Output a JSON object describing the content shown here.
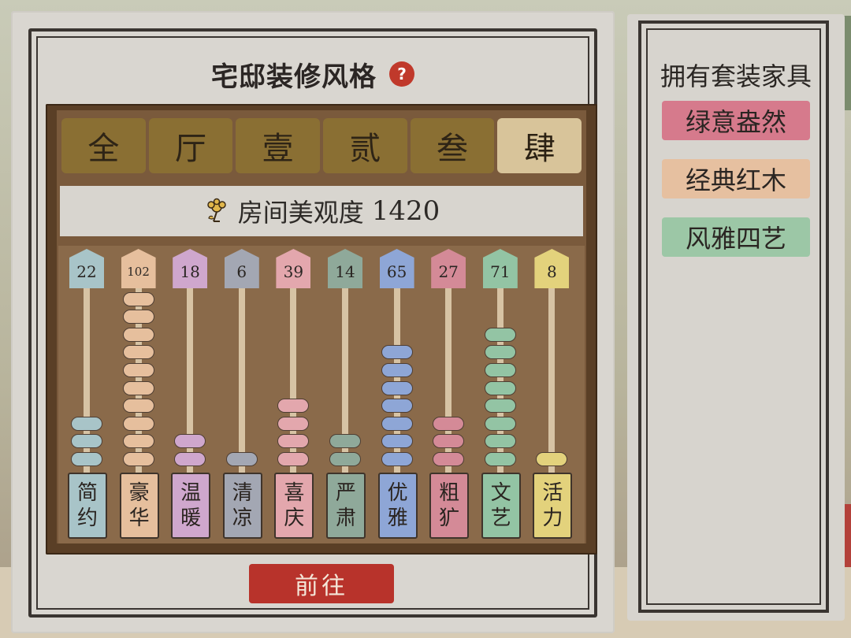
{
  "title": "宅邸装修风格",
  "help_symbol": "?",
  "tabs": [
    "全",
    "厅",
    "壹",
    "贰",
    "叁",
    "肆"
  ],
  "active_tab": 5,
  "beauty": {
    "label": "房间美观度",
    "value": "1420"
  },
  "rods": [
    {
      "count": "22",
      "count_num": 22,
      "name_top": "简",
      "name_bottom": "约",
      "color": "#a8c4c8",
      "beads": 3
    },
    {
      "count": "102",
      "count_num": 102,
      "name_top": "豪",
      "name_bottom": "华",
      "color": "#e6bf9d",
      "beads": 10
    },
    {
      "count": "18",
      "count_num": 18,
      "name_top": "温",
      "name_bottom": "暖",
      "color": "#cfa7cd",
      "beads": 2
    },
    {
      "count": "6",
      "count_num": 6,
      "name_top": "清",
      "name_bottom": "凉",
      "color": "#a3a7b3",
      "beads": 1
    },
    {
      "count": "39",
      "count_num": 39,
      "name_top": "喜",
      "name_bottom": "庆",
      "color": "#e3a7ad",
      "beads": 4
    },
    {
      "count": "14",
      "count_num": 14,
      "name_top": "严",
      "name_bottom": "肃",
      "color": "#8fa99a",
      "beads": 2
    },
    {
      "count": "65",
      "count_num": 65,
      "name_top": "优",
      "name_bottom": "雅",
      "color": "#8ea6d6",
      "beads": 7
    },
    {
      "count": "27",
      "count_num": 27,
      "name_top": "粗",
      "name_bottom": "犷",
      "color": "#d48a97",
      "beads": 3
    },
    {
      "count": "71",
      "count_num": 71,
      "name_top": "文",
      "name_bottom": "艺",
      "color": "#93c4a4",
      "beads": 8
    },
    {
      "count": "8",
      "count_num": 8,
      "name_top": "活",
      "name_bottom": "力",
      "color": "#e3d27c",
      "beads": 1
    }
  ],
  "goto_button": "前往",
  "side_panel": {
    "title": "拥有套装家具",
    "sets": [
      {
        "name": "绿意盎然",
        "color": "#d67a8c"
      },
      {
        "name": "经典红木",
        "color": "#e6c0a0"
      },
      {
        "name": "风雅四艺",
        "color": "#9cc7a6"
      }
    ]
  },
  "colors": {
    "accent_red": "#b8332b",
    "wood_dark": "#5a3f26",
    "tab_inactive": "#8a6f33",
    "tab_active": "#d8c49a"
  }
}
